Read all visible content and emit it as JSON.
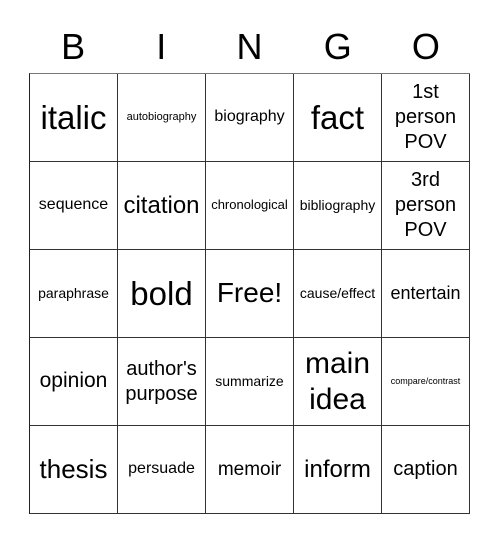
{
  "header": {
    "letters": [
      "B",
      "I",
      "N",
      "G",
      "O"
    ]
  },
  "cells": [
    "italic",
    "autobiography",
    "biography",
    "fact",
    "1st person POV",
    "sequence",
    "citation",
    "chronological",
    "bibliography",
    "3rd person POV",
    "paraphrase",
    "bold",
    "Free!",
    "cause/effect",
    "entertain",
    "opinion",
    "author's purpose",
    "summarize",
    "main idea",
    "compare/contrast",
    "thesis",
    "persuade",
    "memoir",
    "inform",
    "caption"
  ]
}
